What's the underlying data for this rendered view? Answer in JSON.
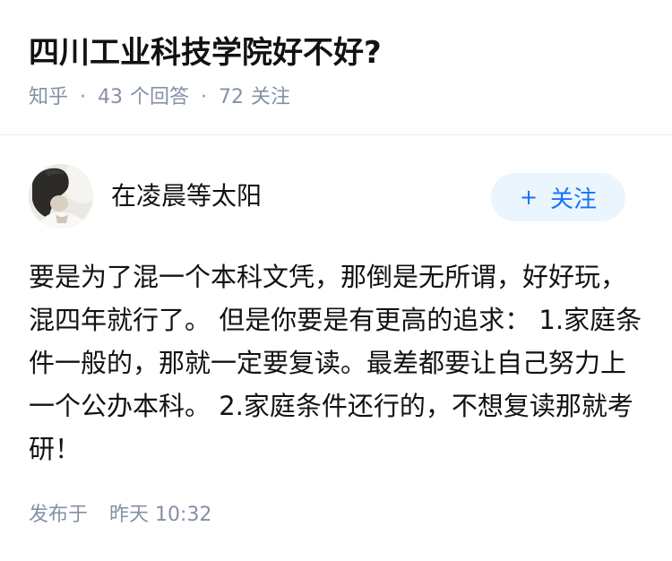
{
  "question": {
    "title": "四川工业科技学院好不好?",
    "source": "知乎",
    "separator": "·",
    "answer_count": "43",
    "answer_label": "个回答",
    "follow_count": "72",
    "follow_label": "关注"
  },
  "answer": {
    "author_name": "在凌晨等太阳",
    "follow_button_label": "关注",
    "follow_button_icon": "plus-icon",
    "content": "要是为了混一个本科文凭，那倒是无所谓，好好玩，混四年就行了。 但是你要是有更高的追求： 1.家庭条件一般的，那就一定要复读。最差都要让自己努力上一个公办本科。 2.家庭条件还行的，不想复读那就考研！",
    "published_label": "发布于",
    "published_day": "昨天",
    "published_time": "10:32"
  },
  "colors": {
    "text_primary": "#121212",
    "text_secondary": "#8590a6",
    "accent": "#1772f6",
    "follow_button_bg": "#ebf5fd",
    "divider": "#ebebeb"
  }
}
